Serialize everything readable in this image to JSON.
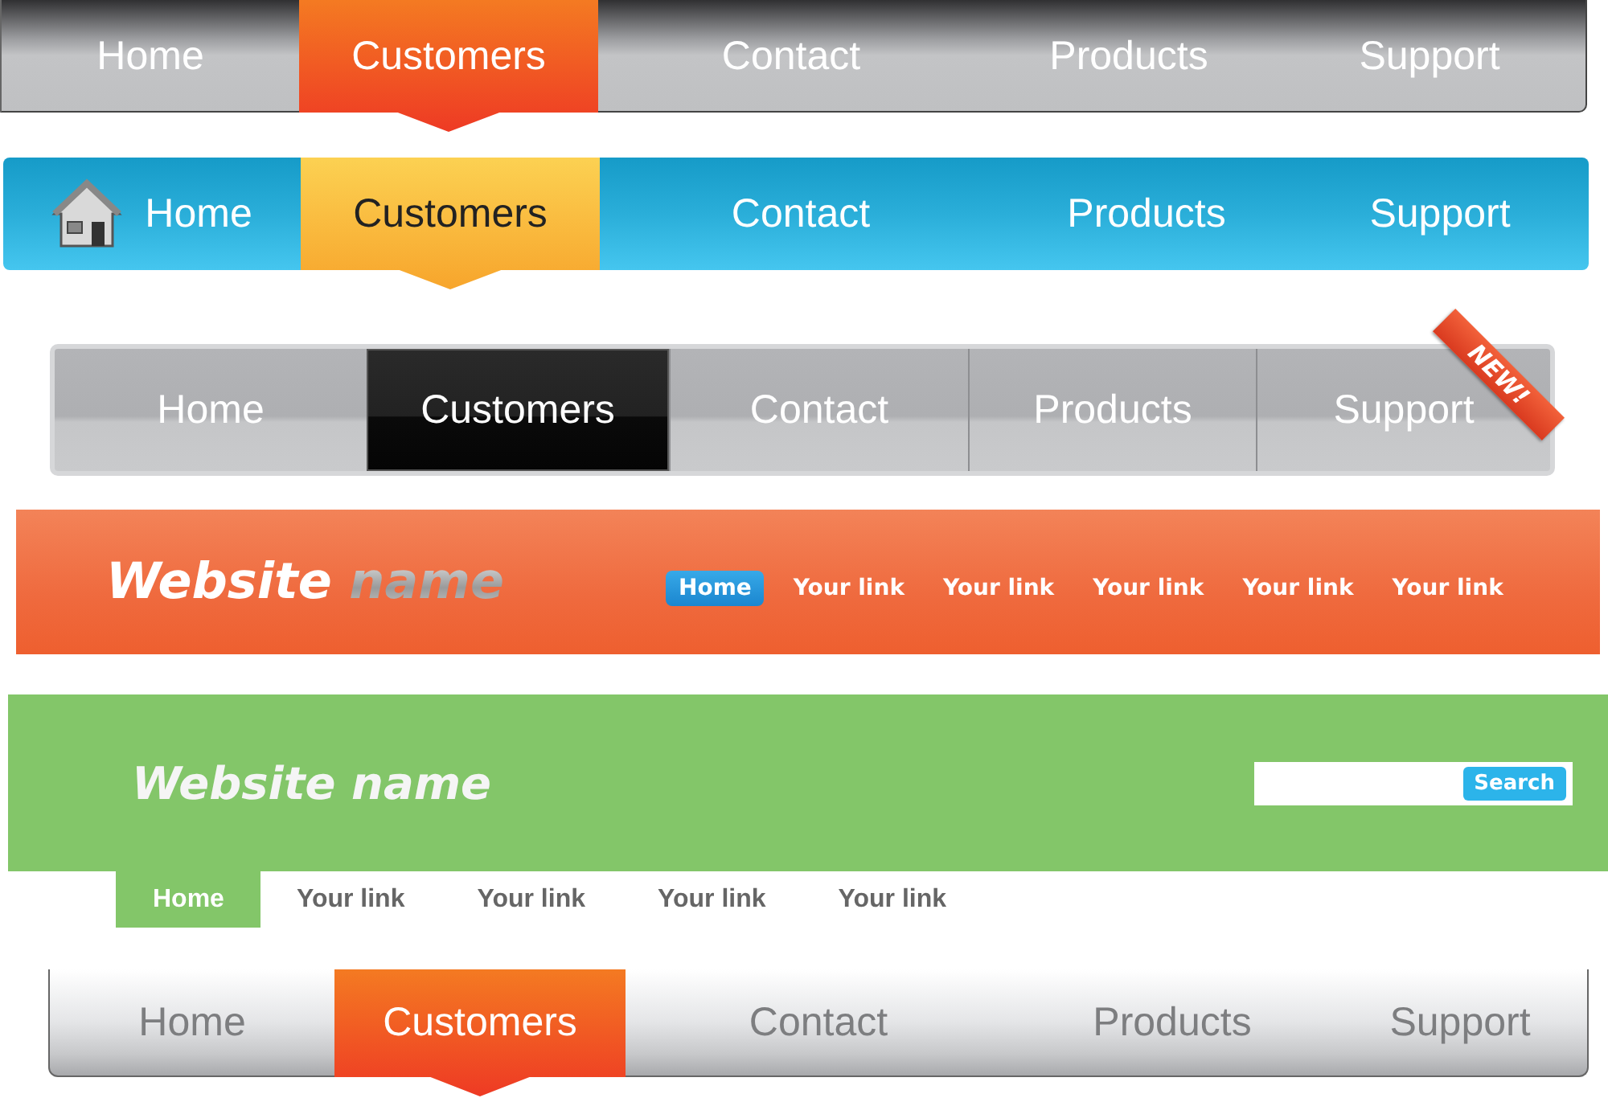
{
  "sections": [
    {
      "kind": "gray-bar",
      "items": [
        {
          "label": "Home",
          "selected": false
        },
        {
          "label": "Customers",
          "selected": true
        },
        {
          "label": "Contact",
          "selected": false
        },
        {
          "label": "Products",
          "selected": false
        },
        {
          "label": "Support",
          "selected": false
        }
      ]
    },
    {
      "kind": "blue-bar",
      "items": [
        {
          "label": "Home",
          "selected": false
        },
        {
          "label": "Customers",
          "selected": true
        },
        {
          "label": "Contact",
          "selected": false
        },
        {
          "label": "Products",
          "selected": false
        },
        {
          "label": "Support",
          "selected": false
        }
      ]
    },
    {
      "kind": "tab-bar",
      "items": [
        {
          "label": "Home",
          "selected": false
        },
        {
          "label": "Customers",
          "selected": true
        },
        {
          "label": "Contact",
          "selected": false
        },
        {
          "label": "Products",
          "selected": false
        },
        {
          "label": "Support",
          "selected": false,
          "badge": "NEW!"
        }
      ]
    },
    {
      "kind": "orange-header",
      "site_name": "Website",
      "site_name_accent": "name",
      "links": [
        {
          "label": "Home",
          "selected": true
        },
        {
          "label": "Your link",
          "selected": false
        },
        {
          "label": "Your link",
          "selected": false
        },
        {
          "label": "Your link",
          "selected": false
        },
        {
          "label": "Your link",
          "selected": false
        },
        {
          "label": "Your link",
          "selected": false
        }
      ]
    },
    {
      "kind": "green-header",
      "site_name": "Website name",
      "search_button": "Search",
      "links": [
        {
          "label": "Home",
          "selected": true
        },
        {
          "label": "Your link",
          "selected": false
        },
        {
          "label": "Your link",
          "selected": false
        },
        {
          "label": "Your link",
          "selected": false
        },
        {
          "label": "Your link",
          "selected": false
        }
      ]
    },
    {
      "kind": "light-bar",
      "items": [
        {
          "label": "Home",
          "selected": false
        },
        {
          "label": "Customers",
          "selected": true
        },
        {
          "label": "Contact",
          "selected": false
        },
        {
          "label": "Products",
          "selected": false
        },
        {
          "label": "Support",
          "selected": false
        }
      ]
    }
  ]
}
